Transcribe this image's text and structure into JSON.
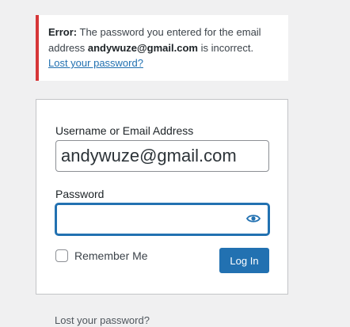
{
  "error_notice": {
    "prefix": "Error:",
    "text_before": " The password you entered for the email address ",
    "email": "andywuze@gmail.com",
    "text_after": " is incorrect.",
    "link": "Lost your password?"
  },
  "login_form": {
    "username_label": "Username or Email Address",
    "username_value": "andywuze@gmail.com",
    "password_label": "Password",
    "password_value": "",
    "show_password_icon": "eye-icon",
    "remember_label": "Remember Me",
    "remember_checked": false,
    "submit_label": "Log In"
  },
  "footer": {
    "lost_password_link": "Lost your password?"
  },
  "colors": {
    "background": "#f0f0f1",
    "error_border": "#d63638",
    "primary": "#2271b1",
    "link": "#2271b1"
  }
}
